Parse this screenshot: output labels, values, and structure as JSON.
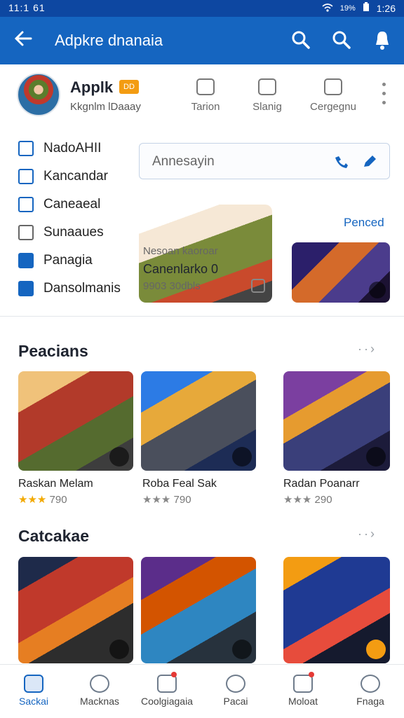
{
  "status": {
    "time_left": "11:1 61",
    "battery_pct": "19%",
    "time_right": "1:26"
  },
  "appbar": {
    "title": "Adpkre dnanaia"
  },
  "profile": {
    "name": "Applk",
    "badge": "DD",
    "subtitle": "Kkgnlm lDaaay"
  },
  "actions": [
    {
      "label": "Tarion"
    },
    {
      "label": "Slanig"
    },
    {
      "label": "Cergegnu"
    }
  ],
  "menu": [
    {
      "label": "NadoAHII"
    },
    {
      "label": "Kancandar"
    },
    {
      "label": "Caneaeal"
    },
    {
      "label": "Sunaaues"
    },
    {
      "label": "Panagia"
    },
    {
      "label": "Dansolmanis"
    }
  ],
  "search": {
    "placeholder": "Annesayin"
  },
  "featured": {
    "label": "Penced",
    "caption_top": "Nesoan kaoroar",
    "caption_main": "Canenlarko 0",
    "caption_sub": "9903 30dbls"
  },
  "sections": [
    {
      "title": "Peacians",
      "tiles": [
        {
          "title": "Raskan Melam",
          "rating": "790",
          "stars": "★★★"
        },
        {
          "title": "Roba Feal Sak",
          "rating": "790",
          "stars": "★★★"
        },
        {
          "title": "Radan Poanarr",
          "rating": "290",
          "stars": "★★★"
        }
      ]
    },
    {
      "title": "Catcakae",
      "tiles": [
        {
          "title": "",
          "rating": "",
          "stars": ""
        },
        {
          "title": "",
          "rating": "",
          "stars": ""
        },
        {
          "title": "",
          "rating": "",
          "stars": ""
        }
      ]
    }
  ],
  "bottom_nav": [
    {
      "label": "Sackai",
      "active": true
    },
    {
      "label": "Macknas",
      "active": false
    },
    {
      "label": "Coolgiagaia",
      "active": false
    },
    {
      "label": "Pacai",
      "active": false
    },
    {
      "label": "Moloat",
      "active": false
    },
    {
      "label": "Fnaga",
      "active": false
    }
  ],
  "colors": {
    "primary": "#1565c0",
    "status_bar": "#0d47a1",
    "accent_star": "#f2a900",
    "badge": "#f39c12"
  }
}
